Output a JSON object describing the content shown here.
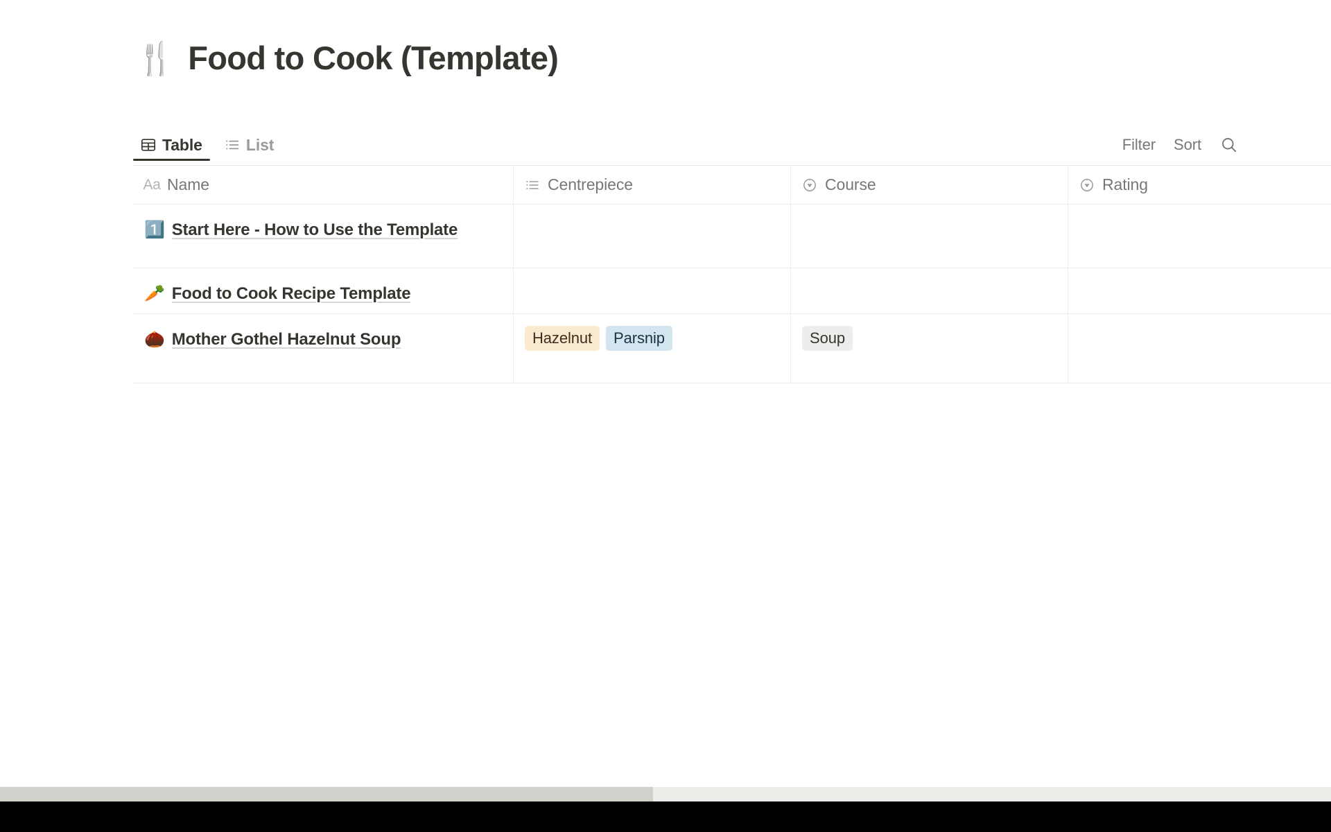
{
  "page": {
    "title_emoji": "🍴",
    "title": "Food to Cook (Template)",
    "background": "#ffffff"
  },
  "toolbar": {
    "tabs": [
      {
        "label": "Table",
        "icon": "table-icon",
        "active": true
      },
      {
        "label": "List",
        "icon": "list-icon",
        "active": false
      }
    ],
    "actions": [
      {
        "label": "Filter",
        "name": "filter-button"
      },
      {
        "label": "Sort",
        "name": "sort-button"
      }
    ],
    "search_icon": "search-icon"
  },
  "table": {
    "columns": [
      {
        "label": "Name",
        "icon": "title-aa-icon",
        "type": "title"
      },
      {
        "label": "Centrepiece",
        "icon": "multi-select-icon",
        "type": "multi_select"
      },
      {
        "label": "Course",
        "icon": "select-icon",
        "type": "select"
      },
      {
        "label": "Rating",
        "icon": "select-icon",
        "type": "select"
      }
    ],
    "rows": [
      {
        "emoji": "1️⃣",
        "name": "Start Here - How to Use the Template",
        "centrepiece": [],
        "course": [],
        "rating": []
      },
      {
        "emoji": "🥕",
        "name": "Food to Cook Recipe Template",
        "centrepiece": [],
        "course": [],
        "rating": []
      },
      {
        "emoji": "🌰",
        "name": "Mother Gothel Hazelnut Soup",
        "centrepiece": [
          {
            "label": "Hazelnut",
            "bg": "#faebd0",
            "fg": "#402c1b"
          },
          {
            "label": "Parsnip",
            "bg": "#d3e5ef",
            "fg": "#183347"
          }
        ],
        "course": [
          {
            "label": "Soup",
            "bg": "#ededec",
            "fg": "#37352f"
          }
        ],
        "rating": []
      }
    ]
  },
  "colors": {
    "text_primary": "#37352f",
    "text_muted": "#787774",
    "text_faint": "#9b9a97",
    "border": "#ebebea",
    "scrollbar_track": "#edece9",
    "scrollbar_thumb": "#d1d0cb"
  }
}
